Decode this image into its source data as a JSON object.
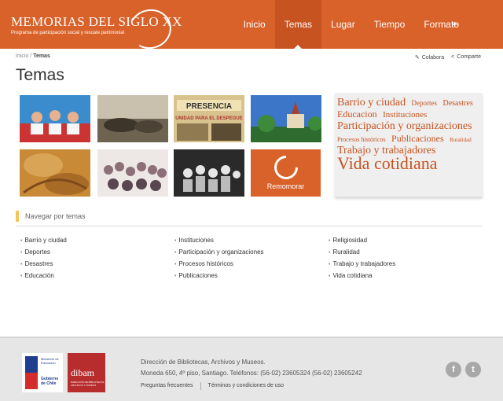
{
  "header": {
    "logo_title": "MEMORIAS DEL SIGLO XX",
    "logo_subtitle": "Programa de participación social y rescate patrimonial",
    "nav": [
      {
        "label": "Inicio"
      },
      {
        "label": "Temas"
      },
      {
        "label": "Lugar"
      },
      {
        "label": "Tiempo"
      },
      {
        "label": "Formato"
      }
    ],
    "more_label": "+"
  },
  "breadcrumb": {
    "home": "Inicio",
    "separator": " / ",
    "current": "Temas"
  },
  "actions": {
    "collaborate": "Colabora",
    "share": "Comparte"
  },
  "page_title": "Temas",
  "remember_tile": {
    "label": "Remomorar"
  },
  "tag_cloud": [
    {
      "label": "Barrio y ciudad",
      "size": 14
    },
    {
      "label": "Deportes",
      "size": 9
    },
    {
      "label": "Desastres",
      "size": 10
    },
    {
      "label": "Educacion",
      "size": 12
    },
    {
      "label": "Instituciones",
      "size": 11
    },
    {
      "label": "Participación y organizaciones",
      "size": 14
    },
    {
      "label": "Procesos históricos",
      "size": 8
    },
    {
      "label": "Publicaciones",
      "size": 12
    },
    {
      "label": "Ruralidad",
      "size": 7
    },
    {
      "label": "Trabajo y trabajadores",
      "size": 14
    },
    {
      "label": "Vida cotidiana",
      "size": 22
    }
  ],
  "browse": {
    "title": "Navegar por temas",
    "columns": [
      [
        "Barrio y ciudad",
        "Deportes",
        "Desastres",
        "Educación"
      ],
      [
        "Instituciones",
        "Participación y organizaciones",
        "Procesos históricos",
        "Publicaciones"
      ],
      [
        "Religiosidad",
        "Ruralidad",
        "Trabajo y trabajadores",
        "Vida cotidiana"
      ]
    ]
  },
  "footer": {
    "gob_line1": "Ministerio de Educación",
    "gob_line2": "Gobierno de Chile",
    "dibam": "dibam",
    "dibam_sub": "DIRECCIÓN DE BIBLIOTECAS, ARCHIVOS Y MUSEOS",
    "address_line1": "Dirección de Bibliotecas, Archivos y Museos.",
    "address_line2": "Moneda 650, 4º piso, Santiago. Teléfonos: (56-02) 23605324 (56-02) 23605242",
    "link_faq": "Preguntas frecuentes",
    "link_terms": "Términos y condiciones de uso",
    "facebook_glyph": "f",
    "twitter_glyph": "t"
  },
  "photo_tiles": {
    "presencia_banner": "PRESENCIA",
    "presencia_slogan": "UNIDAD PARA EL DESPEGUE"
  },
  "colors": {
    "brand": "#d9612a",
    "tag": "#c75320",
    "accent_bar": "#f2c45b"
  }
}
